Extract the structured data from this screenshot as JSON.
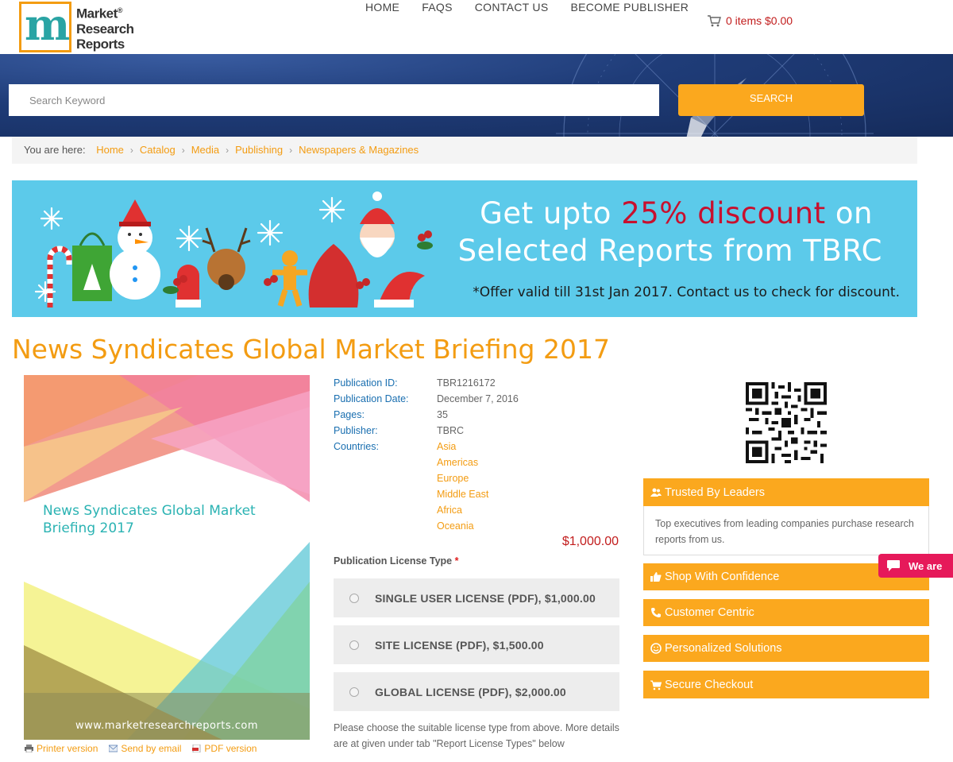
{
  "header": {
    "logo": {
      "line1": "Market",
      "line2": "Research",
      "line3": "Reports",
      "reg": "®",
      "mark": "m"
    },
    "nav": [
      {
        "label": "HOME"
      },
      {
        "label": "FAQS"
      },
      {
        "label": "CONTACT US"
      },
      {
        "label": "BECOME PUBLISHER"
      }
    ],
    "cart": {
      "label": "0 items $0.00",
      "icon": "shopping-cart-icon"
    }
  },
  "search": {
    "placeholder": "Search Keyword",
    "button_label": "SEARCH"
  },
  "breadcrumb": {
    "lead": "You are here:",
    "items": [
      "Home",
      "Catalog",
      "Media",
      "Publishing",
      "Newspapers & Magazines"
    ],
    "separator": "›"
  },
  "banner": {
    "line1_a": "Get upto ",
    "line1_b": "25% discount",
    "line1_c": " on",
    "line2": "Selected Reports from TBRC",
    "line3": "*Offer valid till 31st Jan 2017. Contact us to check for discount."
  },
  "report": {
    "title": "News Syndicates Global Market Briefing 2017",
    "cover_title": "News Syndicates Global Market Briefing 2017",
    "cover_url": "www.marketresearchreports.com",
    "details": {
      "pub_id_label": "Publication ID:",
      "pub_id": "TBR1216172",
      "pub_date_label": "Publication Date:",
      "pub_date": "December 7, 2016",
      "pages_label": "Pages:",
      "pages": "35",
      "publisher_label": "Publisher:",
      "publisher": "TBRC",
      "countries_label": "Countries:",
      "countries": [
        "Asia",
        "Americas",
        "Europe",
        "Middle East",
        "Africa",
        "Oceania"
      ]
    },
    "price": "$1,000.00",
    "license_label": "Publication License Type",
    "license_required": "*",
    "licenses": [
      {
        "label": "SINGLE USER LICENSE (PDF), $1,000.00"
      },
      {
        "label": "SITE LICENSE (PDF), $1,500.00"
      },
      {
        "label": "GLOBAL LICENSE (PDF), $2,000.00"
      }
    ],
    "license_note": "Please choose the suitable license type from above. More details are at given under tab \"Report License Types\" below",
    "links": {
      "printer": "Printer version",
      "email": "Send by email",
      "pdf": "PDF version"
    }
  },
  "sidebar": {
    "trusted": {
      "title": "Trusted By Leaders",
      "body": "Top executives from leading companies purchase research reports from us."
    },
    "boxes": [
      {
        "label": "Shop With Confidence",
        "icon": "thumbs-up-icon"
      },
      {
        "label": "Customer Centric",
        "icon": "phone-icon"
      },
      {
        "label": "Personalized Solutions",
        "icon": "smile-icon"
      },
      {
        "label": "Secure Checkout",
        "icon": "cart-icon"
      }
    ]
  },
  "chat": {
    "label": "We are"
  },
  "colors": {
    "accent": "#fba81e",
    "title": "#f39c12",
    "link": "#1a6fb0",
    "price": "#c21d1d",
    "banner": "#5ccaea"
  }
}
